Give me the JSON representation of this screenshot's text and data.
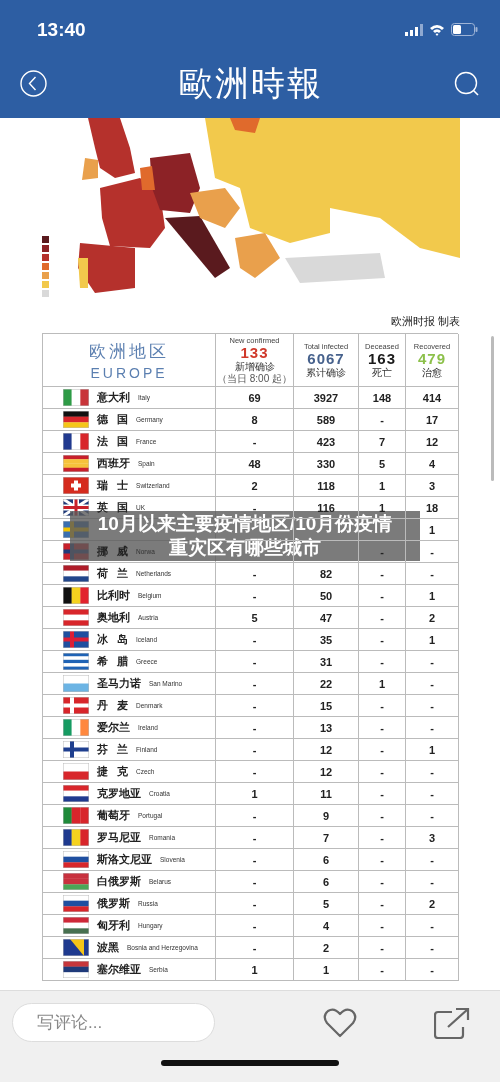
{
  "status_bar": {
    "time": "13:40"
  },
  "nav": {
    "title": "歐洲時報"
  },
  "map": {
    "credit": "欧洲时报 制表"
  },
  "table": {
    "region_zh": "欧洲地区",
    "region_en": "EUROPE",
    "columns": [
      {
        "caption": "New confirmed",
        "total": "133",
        "label": "新增确诊",
        "note": "（当日 8:00 起）",
        "color": "#d0392b"
      },
      {
        "caption": "Total infected",
        "total": "6067",
        "label": "累计确诊",
        "color": "#46618c"
      },
      {
        "caption": "Deceased",
        "total": "163",
        "label": "死亡",
        "color": "#1a1a1a"
      },
      {
        "caption": "Recovered",
        "total": "479",
        "label": "治愈",
        "color": "#8cc04a"
      }
    ],
    "rows": [
      {
        "name_zh": "意大利",
        "name_en": "Italy",
        "cells": [
          "69",
          "3927",
          "148",
          "414"
        ]
      },
      {
        "name_zh": "德 国",
        "name_en": "Germany",
        "cells": [
          "8",
          "589",
          "-",
          "17"
        ]
      },
      {
        "name_zh": "法 国",
        "name_en": "France",
        "cells": [
          "-",
          "423",
          "7",
          "12"
        ]
      },
      {
        "name_zh": "西班牙",
        "name_en": "Spain",
        "cells": [
          "48",
          "330",
          "5",
          "4"
        ]
      },
      {
        "name_zh": "瑞 士",
        "name_en": "Switzerland",
        "cells": [
          "2",
          "118",
          "1",
          "3"
        ]
      },
      {
        "name_zh": "英 国",
        "name_en": "UK",
        "cells": [
          "-",
          "116",
          "1",
          "18"
        ]
      },
      {
        "cells": [
          "",
          "",
          "",
          "1"
        ]
      },
      {
        "name_zh": "挪 威",
        "name_en": "Norwa",
        "cells": [
          "",
          "",
          "-",
          "-"
        ]
      },
      {
        "name_zh": "荷 兰",
        "name_en": "Netherlands",
        "cells": [
          "-",
          "82",
          "-",
          "-"
        ]
      },
      {
        "name_zh": "比利时",
        "name_en": "Belgium",
        "cells": [
          "-",
          "50",
          "-",
          "1"
        ]
      },
      {
        "name_zh": "奥地利",
        "name_en": "Austria",
        "cells": [
          "5",
          "47",
          "-",
          "2"
        ]
      },
      {
        "name_zh": "冰 岛",
        "name_en": "Iceland",
        "cells": [
          "-",
          "35",
          "-",
          "1"
        ]
      },
      {
        "name_zh": "希 腊",
        "name_en": "Greece",
        "cells": [
          "-",
          "31",
          "-",
          "-"
        ]
      },
      {
        "name_zh": "圣马力诺",
        "name_en": "San Marino",
        "cells": [
          "-",
          "22",
          "1",
          "-"
        ]
      },
      {
        "name_zh": "丹 麦",
        "name_en": "Denmark",
        "cells": [
          "-",
          "15",
          "-",
          "-"
        ]
      },
      {
        "name_zh": "爱尔兰",
        "name_en": "Ireland",
        "cells": [
          "-",
          "13",
          "-",
          "-"
        ]
      },
      {
        "name_zh": "芬 兰",
        "name_en": "Finland",
        "cells": [
          "-",
          "12",
          "-",
          "1"
        ]
      },
      {
        "name_zh": "捷 克",
        "name_en": "Czech",
        "cells": [
          "-",
          "12",
          "-",
          "-"
        ]
      },
      {
        "name_zh": "克罗地亚",
        "name_en": "Croatia",
        "cells": [
          "1",
          "11",
          "-",
          "-"
        ]
      },
      {
        "name_zh": "葡萄牙",
        "name_en": "Portugal",
        "cells": [
          "-",
          "9",
          "-",
          "-"
        ]
      },
      {
        "name_zh": "罗马尼亚",
        "name_en": "Romania",
        "cells": [
          "-",
          "7",
          "-",
          "3"
        ]
      },
      {
        "name_zh": "斯洛文尼亚",
        "name_en": "Slovenia",
        "cells": [
          "-",
          "6",
          "-",
          "-"
        ]
      },
      {
        "name_zh": "白俄罗斯",
        "name_en": "Belarus",
        "cells": [
          "-",
          "6",
          "-",
          "-"
        ]
      },
      {
        "name_zh": "俄罗斯",
        "name_en": "Russia",
        "cells": [
          "-",
          "5",
          "-",
          "2"
        ]
      },
      {
        "name_zh": "匈牙利",
        "name_en": "Hungary",
        "cells": [
          "-",
          "4",
          "-",
          "-"
        ]
      },
      {
        "name_zh": "波黑",
        "name_en": "Bosnia and Herzegovina",
        "cells": [
          "-",
          "2",
          "-",
          "-"
        ]
      },
      {
        "name_zh": "塞尔维亚",
        "name_en": "Serbia",
        "cells": [
          "1",
          "1",
          "-",
          "-"
        ]
      }
    ],
    "caption_lines": [
      "10月以来主要疫情地区/10月份疫情",
      "重灾区有哪些城市"
    ]
  },
  "bottom_bar": {
    "comment": {
      "placeholder": "写评论..."
    }
  }
}
